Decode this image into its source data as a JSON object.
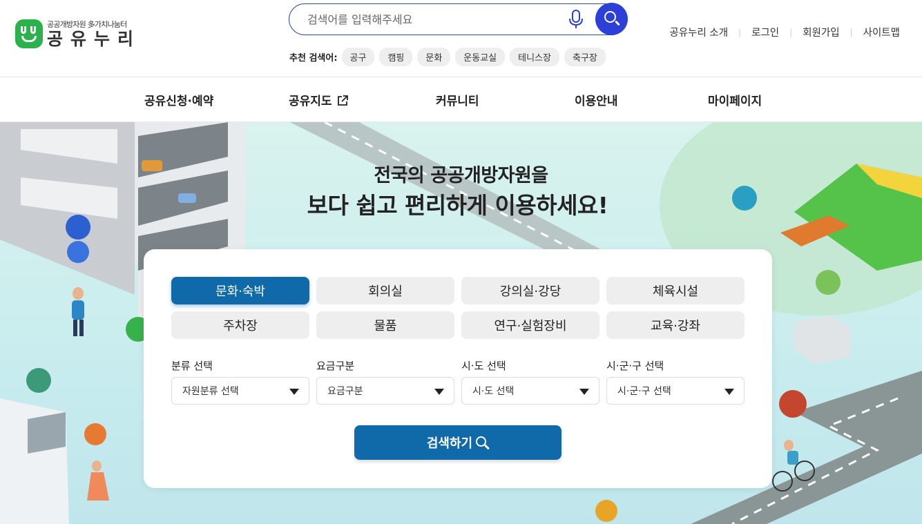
{
  "brand": {
    "sub": "공공개방자원 多가치나눔터",
    "name": "공유누리",
    "color": "#2bb24c"
  },
  "search": {
    "placeholder": "검색어를 입력해주세요",
    "button_color": "#2c3fd6"
  },
  "recommend": {
    "label": "추천 검색어:",
    "keywords": [
      "공구",
      "캠핑",
      "문화",
      "운동교실",
      "테니스장",
      "축구장"
    ]
  },
  "util_links": [
    "공유누리 소개",
    "로그인",
    "회원가입",
    "사이트맵"
  ],
  "nav": {
    "items": [
      "공유신청·예약",
      "공유지도",
      "커뮤니티",
      "이용안내",
      "마이페이지"
    ]
  },
  "hero": {
    "title1": "전국의 공공개방자원을",
    "title2": "보다 쉽고 편리하게 이용하세요!"
  },
  "categories": [
    {
      "label": "문화·숙박",
      "active": true
    },
    {
      "label": "회의실",
      "active": false
    },
    {
      "label": "강의실·강당",
      "active": false
    },
    {
      "label": "체육시설",
      "active": false
    },
    {
      "label": "주차장",
      "active": false
    },
    {
      "label": "물품",
      "active": false
    },
    {
      "label": "연구·실험장비",
      "active": false
    },
    {
      "label": "교육·강좌",
      "active": false
    }
  ],
  "filters": [
    {
      "label": "분류 선택",
      "value": "자원분류 선택"
    },
    {
      "label": "요금구분",
      "value": "요금구분"
    },
    {
      "label": "시·도 선택",
      "value": "시·도 선택"
    },
    {
      "label": "시·군·구 선택",
      "value": "시·군·구 선택"
    }
  ],
  "submit_label": "검색하기",
  "accent_color": "#1069a8"
}
